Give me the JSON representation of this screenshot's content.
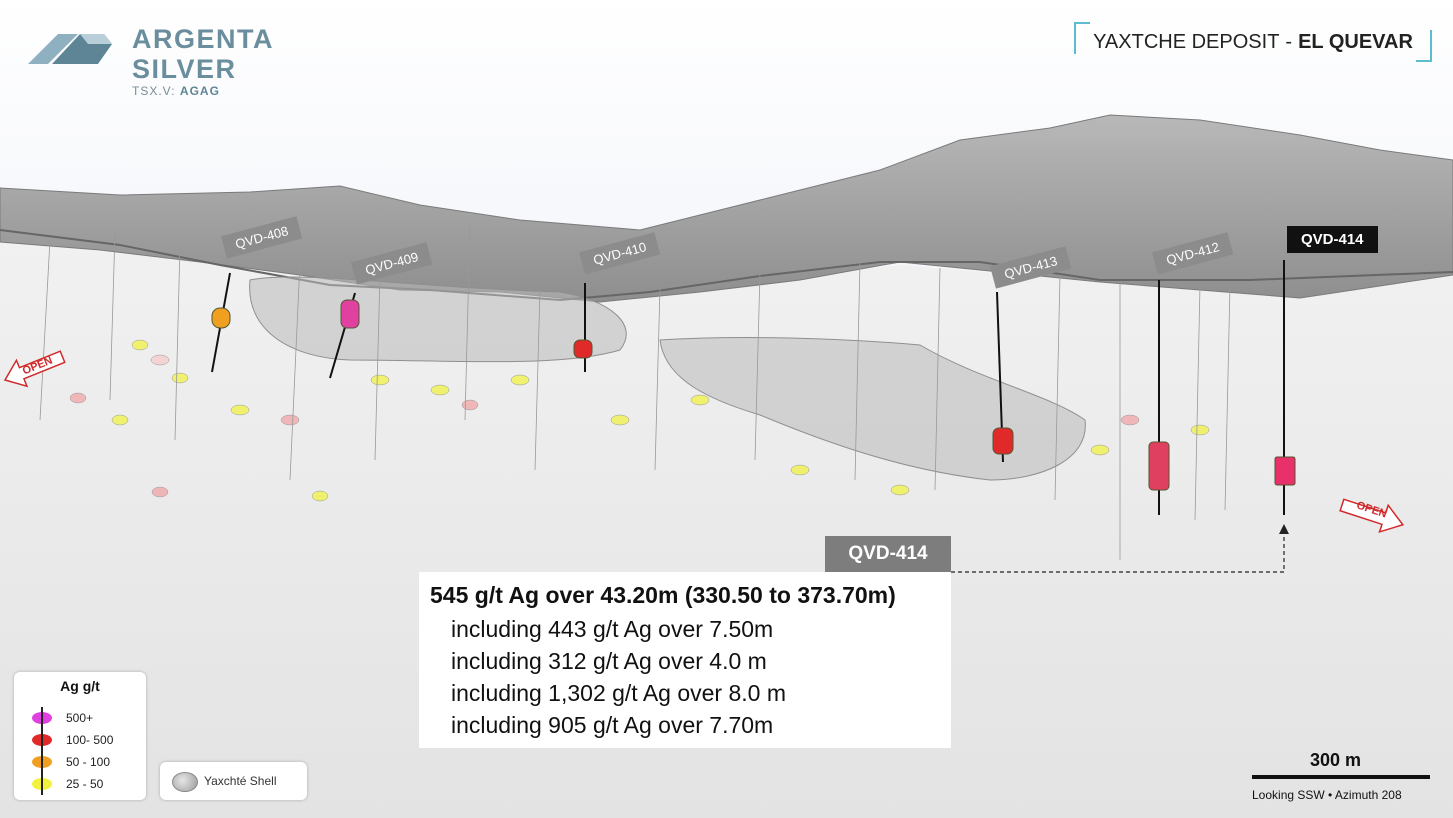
{
  "brand": {
    "name": "ARGENTA SILVER",
    "exchange": "TSX.V:",
    "ticker": "AGAG"
  },
  "title": {
    "main": "YAXTCHE DEPOSIT",
    "separator": "-",
    "bold": "EL QUEVAR"
  },
  "holes": [
    {
      "label": "QVD-408"
    },
    {
      "label": "QVD-409"
    },
    {
      "label": "QVD-410"
    },
    {
      "label": "QVD-413"
    },
    {
      "label": "QVD-412"
    },
    {
      "label": "QVD-414"
    }
  ],
  "open_label": "OPEN",
  "callout": {
    "tag": "QVD-414",
    "headline": "545 g/t Ag over 43.20m (330.50 to 373.70m)",
    "lines": [
      "including 443 g/t Ag over 7.50m",
      "including 312 g/t Ag over 4.0 m",
      "including 1,302 g/t Ag over 8.0 m",
      "including 905 g/t Ag over 7.70m"
    ]
  },
  "legend": {
    "title": "Ag g/t",
    "items": [
      {
        "label": "500+",
        "color": "#e040e0"
      },
      {
        "label": "100- 500",
        "color": "#e02a2a"
      },
      {
        "label": "50 - 100",
        "color": "#f0a020"
      },
      {
        "label": "25 - 50",
        "color": "#f2f23a"
      }
    ]
  },
  "shell_legend": {
    "label": "Yaxchté Shell"
  },
  "scale": {
    "distance": "300 m",
    "view": "Looking SSW",
    "azimuth": "Azimuth 208"
  },
  "colors": {
    "brand": "#6b8e9e",
    "accent": "#5dbdd0",
    "open_arrow": "#d12a2a"
  }
}
